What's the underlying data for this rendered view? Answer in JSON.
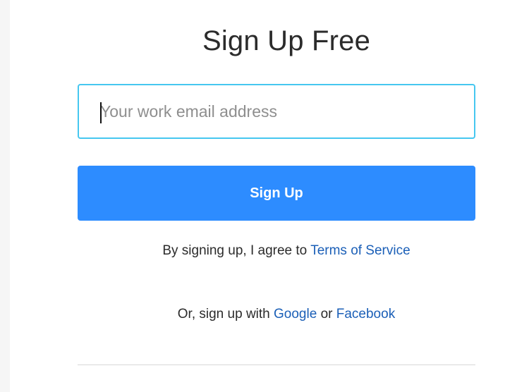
{
  "title": "Sign Up Free",
  "email": {
    "placeholder": "Your work email address",
    "value": ""
  },
  "signup_button": {
    "label": "Sign Up"
  },
  "terms": {
    "prefix": "By signing up, I agree to ",
    "link": "Terms of Service"
  },
  "alternatives": {
    "prefix": "Or, sign up with ",
    "google": "Google",
    "separator": " or ",
    "facebook": "Facebook"
  },
  "colors": {
    "primary_button": "#2d8cff",
    "input_focus_border": "#46c7f0",
    "link": "#1b5fb7"
  }
}
